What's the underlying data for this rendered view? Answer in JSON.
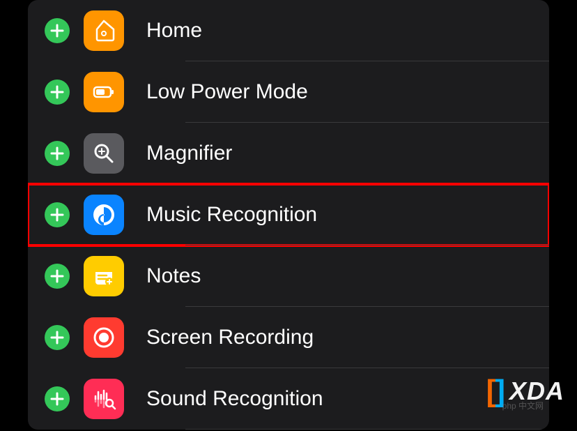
{
  "items": [
    {
      "label": "Home",
      "icon": "home",
      "bg": "icon-home",
      "highlight": false
    },
    {
      "label": "Low Power Mode",
      "icon": "lowpower",
      "bg": "icon-lowpower",
      "highlight": false
    },
    {
      "label": "Magnifier",
      "icon": "magnifier",
      "bg": "icon-magnifier",
      "highlight": false
    },
    {
      "label": "Music Recognition",
      "icon": "music",
      "bg": "icon-music",
      "highlight": true
    },
    {
      "label": "Notes",
      "icon": "notes",
      "bg": "icon-notes",
      "highlight": false
    },
    {
      "label": "Screen Recording",
      "icon": "recording",
      "bg": "icon-recording",
      "highlight": false
    },
    {
      "label": "Sound Recognition",
      "icon": "sound",
      "bg": "icon-sound",
      "highlight": false
    }
  ],
  "watermark": {
    "brand": "XDA",
    "sub": "php 中文网"
  }
}
